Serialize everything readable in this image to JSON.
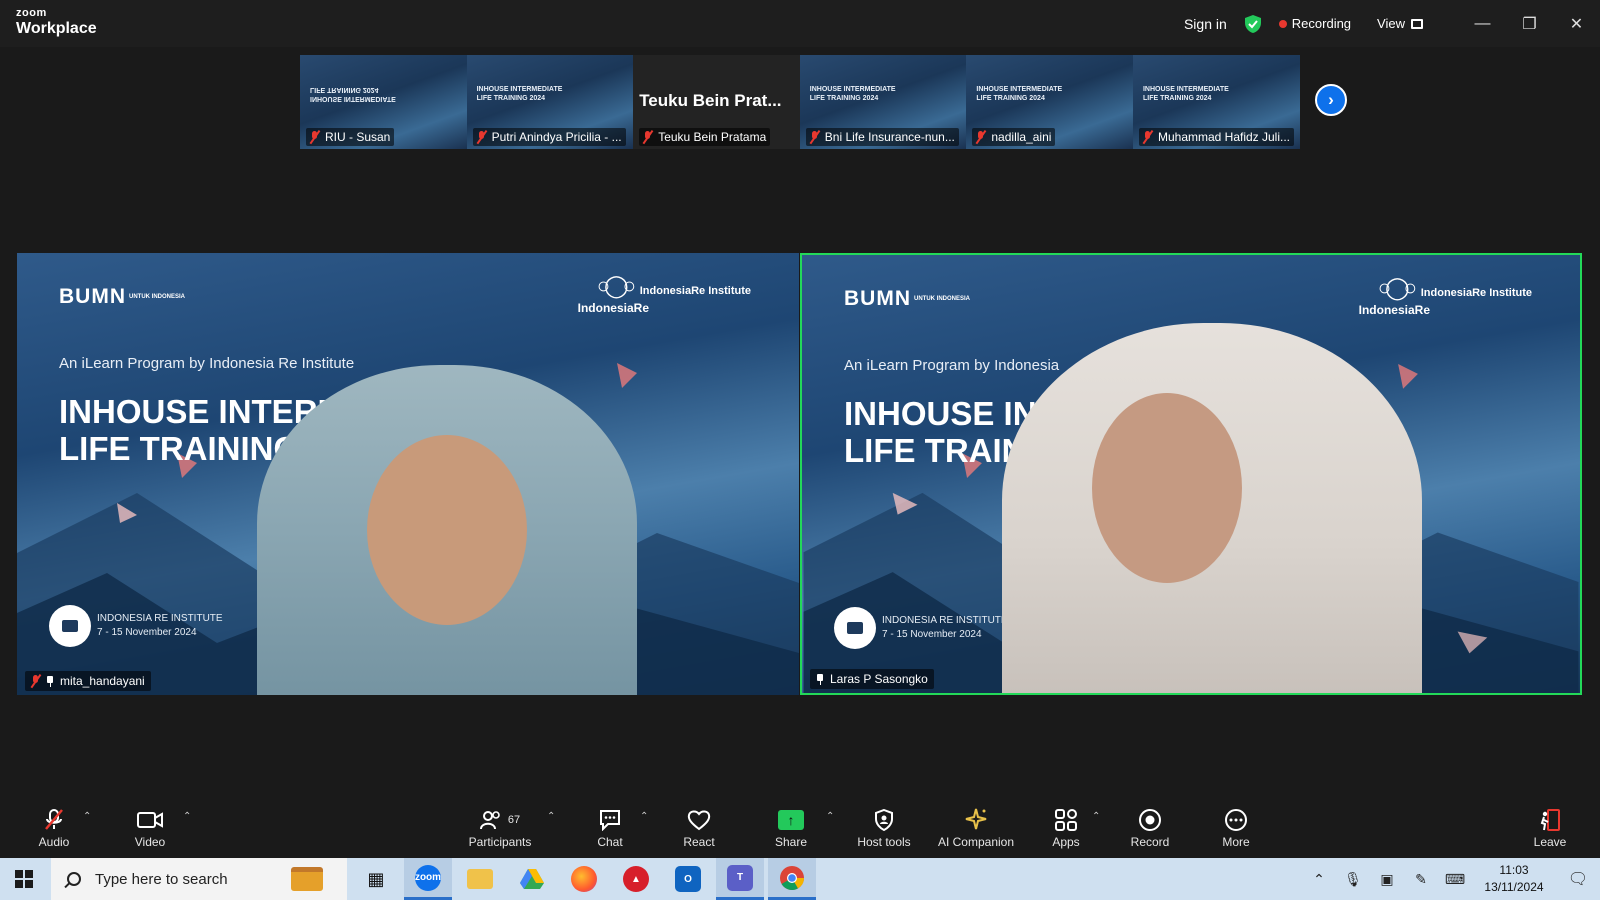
{
  "titlebar": {
    "brand_line1": "zoom",
    "brand_line2": "Workplace",
    "sign_in": "Sign in",
    "recording": "Recording",
    "view": "View"
  },
  "strip": {
    "thumbnails": [
      {
        "name": "RIU - Susan",
        "slide_title": "INHOUSE INTERMEDIATE LIFE TRAINING 2024",
        "muted": true
      },
      {
        "name": "Putri Anindya Pricilia - ...",
        "slide_title": "INHOUSE INTERMEDIATE LIFE TRAINING 2024",
        "muted": true
      },
      {
        "name": "Teuku Bein Pratama",
        "display_name": "Teuku Bein Prat...",
        "muted": true
      },
      {
        "name": "Bni Life Insurance-nun...",
        "slide_title": "INHOUSE INTERMEDIATE LIFE TRAINING 2024",
        "muted": true
      },
      {
        "name": "nadilla_aini",
        "slide_title": "INHOUSE INTERMEDIATE LIFE TRAINING 2024",
        "muted": true
      },
      {
        "name": "Muhammad Hafidz Juli...",
        "slide_title": "INHOUSE INTERMEDIATE LIFE TRAINING 2024",
        "muted": true
      }
    ]
  },
  "tiles": [
    {
      "name": "mita_handayani",
      "brand_bumn": "BUMN",
      "brand_bumn_sub": "UNTUK INDONESIA",
      "brand_ire": "IndonesiaRe",
      "brand_iri": "IndonesiaRe Institute",
      "program": "An iLearn Program by Indonesia Re Institute",
      "title_line1": "INHOUSE INTERME",
      "title_line2": "LIFE TRAINING 20",
      "inst_name": "INDONESIA RE INSTITUTE",
      "inst_date": "7 - 15 November 2024"
    },
    {
      "name": "Laras P Sasongko",
      "brand_bumn": "BUMN",
      "brand_bumn_sub": "UNTUK INDONESIA",
      "brand_ire": "IndonesiaRe",
      "brand_iri": "IndonesiaRe Institute",
      "program": "An iLearn Program by Indonesia",
      "title_line1": "INHOUSE INT",
      "title_line2": "LIFE TRAININ",
      "inst_name": "INDONESIA RE INSTITUTE",
      "inst_date": "7 - 15 November 2024"
    }
  ],
  "toolbar": {
    "audio": "Audio",
    "video": "Video",
    "participants": "Participants",
    "participants_count": "67",
    "chat": "Chat",
    "react": "React",
    "share": "Share",
    "host_tools": "Host tools",
    "ai_companion": "AI Companion",
    "apps": "Apps",
    "record": "Record",
    "more": "More",
    "leave": "Leave"
  },
  "taskbar": {
    "search_placeholder": "Type here to search",
    "time": "11:03",
    "date": "13/11/2024"
  },
  "colors": {
    "active_speaker": "#23d959",
    "recording_dot": "#e8382f",
    "share_green": "#23c95b",
    "zoom_blue": "#0e71eb"
  }
}
